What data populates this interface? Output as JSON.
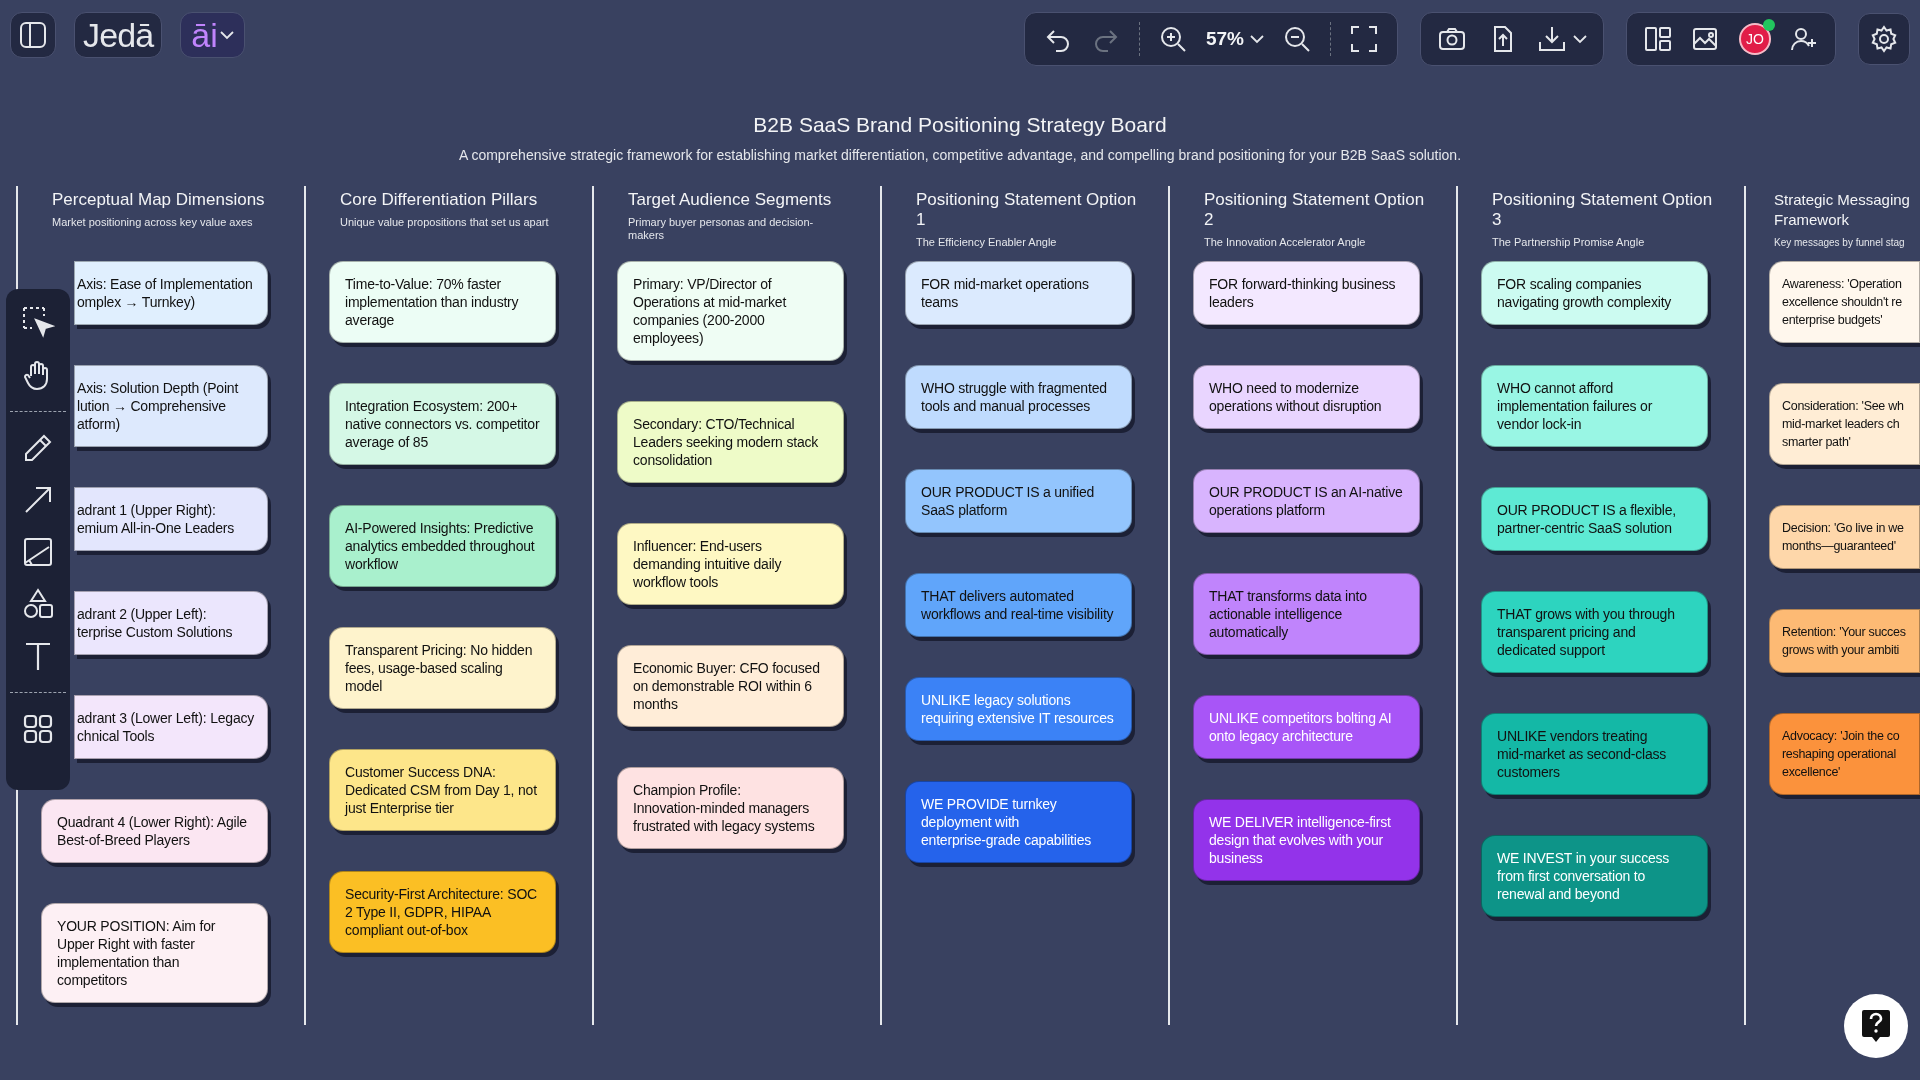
{
  "app": {
    "logo": "Jedā",
    "ai_button": "āi"
  },
  "toolbar": {
    "zoom": "57%",
    "redo_disabled": true,
    "avatar": {
      "initials": "JO",
      "online": true
    }
  },
  "board": {
    "title": "B2B SaaS Brand Positioning Strategy Board",
    "subtitle": "A comprehensive strategic framework for establishing market differentiation, competitive advantage, and compelling brand positioning for your B2B SaaS solution."
  },
  "columns": [
    {
      "title": "Perceptual Map Dimensions",
      "subtitle": "Market positioning across key value axes",
      "cards": [
        {
          "kind": "covered",
          "color": "#e0effe",
          "lines": [
            "Axis: Ease of Implementation",
            "omplex → Turnkey)"
          ]
        },
        {
          "kind": "covered",
          "color": "#dde9fd",
          "lines": [
            "Axis: Solution Depth (Point",
            "lution → Comprehensive",
            "atform)"
          ]
        },
        {
          "kind": "covered",
          "color": "#e3e6fd",
          "lines": [
            "adrant 1 (Upper Right):",
            "emium All-in-One Leaders"
          ]
        },
        {
          "kind": "covered",
          "color": "#ebe6fd",
          "lines": [
            "adrant 2 (Upper Left):",
            "terprise Custom Solutions"
          ]
        },
        {
          "kind": "covered",
          "color": "#f3e6fb",
          "lines": [
            "adrant 3 (Lower Left): Legacy",
            "chnical Tools"
          ]
        },
        {
          "kind": "note",
          "color": "#fbe6f2",
          "lines": [
            "Quadrant 4 (Lower Right): Agile",
            "Best-of-Breed Players"
          ]
        },
        {
          "kind": "note",
          "color": "#fdf0f4",
          "lines": [
            "YOUR POSITION: Aim for",
            "Upper Right with faster",
            "implementation than",
            "competitors"
          ]
        }
      ]
    },
    {
      "title": "Core Differentiation Pillars",
      "subtitle": "Unique value propositions that set us apart",
      "cards": [
        {
          "kind": "note",
          "color": "#ecfdf5",
          "lines": [
            "Time-to-Value: 70% faster",
            "implementation than industry",
            "average"
          ]
        },
        {
          "kind": "note",
          "color": "#d5f8e6",
          "lines": [
            "Integration Ecosystem: 200+",
            "native connectors vs. competitor",
            "average of 85"
          ]
        },
        {
          "kind": "note",
          "color": "#a9f0cd",
          "lines": [
            "AI-Powered Insights: Predictive",
            "analytics embedded throughout",
            "workflow"
          ]
        },
        {
          "kind": "note",
          "color": "#fef3cc",
          "lines": [
            "Transparent Pricing: No hidden",
            "fees, usage-based scaling",
            "model"
          ]
        },
        {
          "kind": "note",
          "color": "#fde68a",
          "lines": [
            "Customer Success DNA:",
            "Dedicated CSM from Day 1, not",
            "just Enterprise tier"
          ]
        },
        {
          "kind": "note",
          "color": "#fbbf24",
          "lines": [
            "Security-First Architecture: SOC",
            "2 Type II, GDPR, HIPAA",
            "compliant out-of-box"
          ]
        }
      ]
    },
    {
      "title": "Target Audience Segments",
      "subtitle": "Primary buyer personas and decision-makers",
      "cards": [
        {
          "kind": "note",
          "color": "#effdf4",
          "lines": [
            "Primary: VP/Director of",
            "Operations at mid-market",
            "companies (200-2000",
            "employees)"
          ]
        },
        {
          "kind": "note",
          "color": "#eefbc8",
          "lines": [
            "Secondary: CTO/Technical",
            "Leaders seeking modern stack",
            "consolidation"
          ]
        },
        {
          "kind": "note",
          "color": "#fef8c3",
          "lines": [
            "Influencer: End-users",
            "demanding intuitive daily",
            "workflow tools"
          ]
        },
        {
          "kind": "note",
          "color": "#ffedd8",
          "lines": [
            "Economic Buyer: CFO focused",
            "on demonstrable ROI within 6",
            "months"
          ]
        },
        {
          "kind": "note",
          "color": "#fee2e2",
          "lines": [
            "Champion Profile:",
            "Innovation-minded managers",
            "frustrated with legacy systems"
          ]
        }
      ]
    },
    {
      "title": "Positioning Statement Option 1",
      "subtitle": "The Efficiency Enabler Angle",
      "cards": [
        {
          "kind": "note",
          "color": "#dbeafe",
          "lines": [
            "FOR mid-market operations",
            "teams"
          ]
        },
        {
          "kind": "note",
          "color": "#bfdbfe",
          "lines": [
            "WHO struggle with fragmented",
            "tools and manual processes"
          ]
        },
        {
          "kind": "note",
          "color": "#93c5fd",
          "lines": [
            "OUR PRODUCT IS a unified",
            "SaaS platform"
          ]
        },
        {
          "kind": "note",
          "color": "#60a5fa",
          "lines": [
            "THAT delivers automated",
            "workflows and real-time visibility"
          ]
        },
        {
          "kind": "note",
          "color": "#3b82f6",
          "lines": [
            "UNLIKE legacy solutions",
            "requiring extensive IT resources"
          ]
        },
        {
          "kind": "note",
          "color": "#2563eb",
          "lines": [
            "WE PROVIDE turnkey",
            "deployment with",
            "enterprise-grade capabilities"
          ]
        }
      ]
    },
    {
      "title": "Positioning Statement Option 2",
      "subtitle": "The Innovation Accelerator Angle",
      "cards": [
        {
          "kind": "note",
          "color": "#f3e8ff",
          "lines": [
            "FOR forward-thinking business",
            "leaders"
          ]
        },
        {
          "kind": "note",
          "color": "#e9d5ff",
          "lines": [
            "WHO need to modernize",
            "operations without disruption"
          ]
        },
        {
          "kind": "note",
          "color": "#d8b4fe",
          "lines": [
            "OUR PRODUCT IS an AI-native",
            "operations platform"
          ]
        },
        {
          "kind": "note",
          "color": "#c084fc",
          "lines": [
            "THAT transforms data into",
            "actionable intelligence",
            "automatically"
          ]
        },
        {
          "kind": "note",
          "color": "#a855f7",
          "lines": [
            "UNLIKE competitors bolting AI",
            "onto legacy architecture"
          ]
        },
        {
          "kind": "note",
          "color": "#9333ea",
          "lines": [
            "WE DELIVER intelligence-first",
            "design that evolves with your",
            "business"
          ]
        }
      ]
    },
    {
      "title": "Positioning Statement Option 3",
      "subtitle": "The Partnership Promise Angle",
      "cards": [
        {
          "kind": "note",
          "color": "#ccfbf1",
          "lines": [
            "FOR scaling companies",
            "navigating growth complexity"
          ]
        },
        {
          "kind": "note",
          "color": "#99f6e4",
          "lines": [
            "WHO cannot afford",
            "implementation failures or",
            "vendor lock-in"
          ]
        },
        {
          "kind": "note",
          "color": "#5eead4",
          "lines": [
            "OUR PRODUCT IS a flexible,",
            "partner-centric SaaS solution"
          ]
        },
        {
          "kind": "note",
          "color": "#2dd4bf",
          "lines": [
            "THAT grows with you through",
            "transparent pricing and",
            "dedicated support"
          ]
        },
        {
          "kind": "note",
          "color": "#14b8a6",
          "lines": [
            "UNLIKE vendors treating",
            "mid-market as second-class",
            "customers"
          ]
        },
        {
          "kind": "note",
          "color": "#0d9488",
          "lines": [
            "WE INVEST in your success",
            "from first conversation to",
            "renewal and beyond"
          ]
        }
      ]
    },
    {
      "title": "Strategic Messaging Framework",
      "subtitle": "Key messages by funnel stag",
      "cards": [
        {
          "kind": "cut",
          "color": "#fff7ed",
          "lines": [
            "Awareness: 'Operation",
            "excellence shouldn't re",
            "enterprise budgets'"
          ]
        },
        {
          "kind": "cut",
          "color": "#ffedd5",
          "lines": [
            "Consideration: 'See wh",
            "mid-market leaders ch",
            "smarter path'"
          ]
        },
        {
          "kind": "cut",
          "color": "#fed7aa",
          "lines": [
            "Decision: 'Go live in we",
            "months—guaranteed'"
          ]
        },
        {
          "kind": "cut",
          "color": "#fdba74",
          "lines": [
            "Retention: 'Your succes",
            "grows with your ambiti"
          ]
        },
        {
          "kind": "cut",
          "color": "#fb923c",
          "lines": [
            "Advocacy: 'Join the co",
            "reshaping operational",
            "excellence'"
          ]
        }
      ]
    }
  ]
}
